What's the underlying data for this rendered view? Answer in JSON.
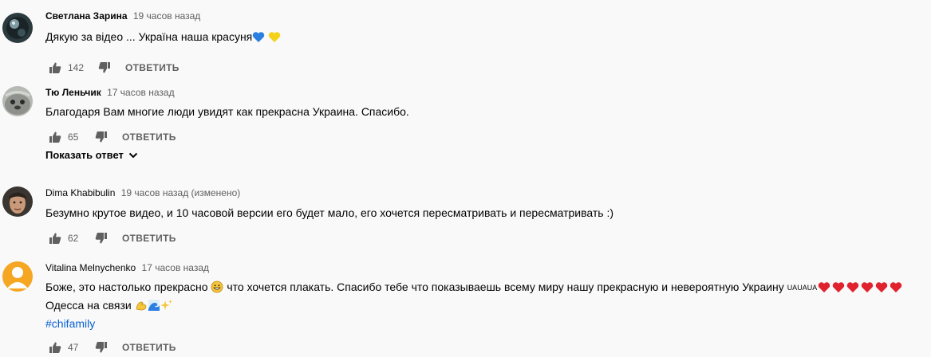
{
  "reply_label": "ОТВЕТИТЬ",
  "show_replies_label": "Показать ответ",
  "comments": [
    {
      "author": "Светлана Зарина",
      "time": "19 часов назад",
      "text": "Дякую за відео ... Україна наша красуня",
      "emoji": [
        "blue-heart",
        "yellow-heart"
      ],
      "likes": "142"
    },
    {
      "author": "Тю Леньчик",
      "time": "17 часов назад",
      "text": "Благодаря Вам многие люди увидят как прекрасна Украина. Спасибо.",
      "likes": "65"
    },
    {
      "author": "Dima Khabibulin",
      "time": "19 часов назад (изменено)",
      "text": "Безумно крутое видео, и 10 часовой версии его будет мало, его хочется пересматривать и пересматривать :)",
      "likes": "62"
    },
    {
      "author": "Vitalina Melnychenko",
      "time": "17 часов назад",
      "text_part1": "Боже, это настолько прекрасно",
      "text_part2": "что хочется плакать. Спасибо тебе что показываешь всему миру нашу прекрасную и невероятную Украину",
      "small_text": "UAUAUA",
      "line2": "Одесса на связи",
      "hashtag": "#chifamily",
      "emoji": [
        "grinning-face",
        "red-heart",
        "flexed-biceps",
        "water-wave",
        "sparkles"
      ],
      "likes": "47"
    }
  ],
  "colors": {
    "text": "#030303",
    "secondary": "#606060",
    "link": "#065fd4",
    "background": "#f9f9f9"
  }
}
